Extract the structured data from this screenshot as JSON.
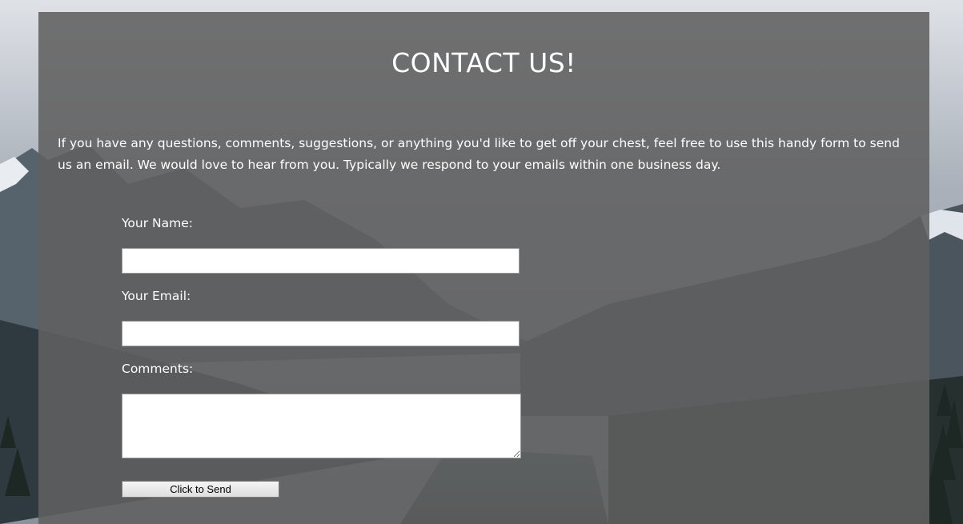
{
  "page": {
    "title": "CONTACT US!",
    "intro": "If you have any questions, comments, suggestions, or anything you'd like to get off your chest, feel free to use this handy form to send us an email. We would love to hear from you. Typically we respond to your emails within one business day."
  },
  "form": {
    "name_label": "Your Name:",
    "name_value": "",
    "email_label": "Your Email:",
    "email_value": "",
    "comments_label": "Comments:",
    "comments_value": "",
    "send_label": "Click to Send"
  },
  "colors": {
    "panel": "#606060",
    "text": "#ffffff",
    "button": "#e8e8e8"
  },
  "background": {
    "description_icon": "mountain-lake-photo"
  }
}
